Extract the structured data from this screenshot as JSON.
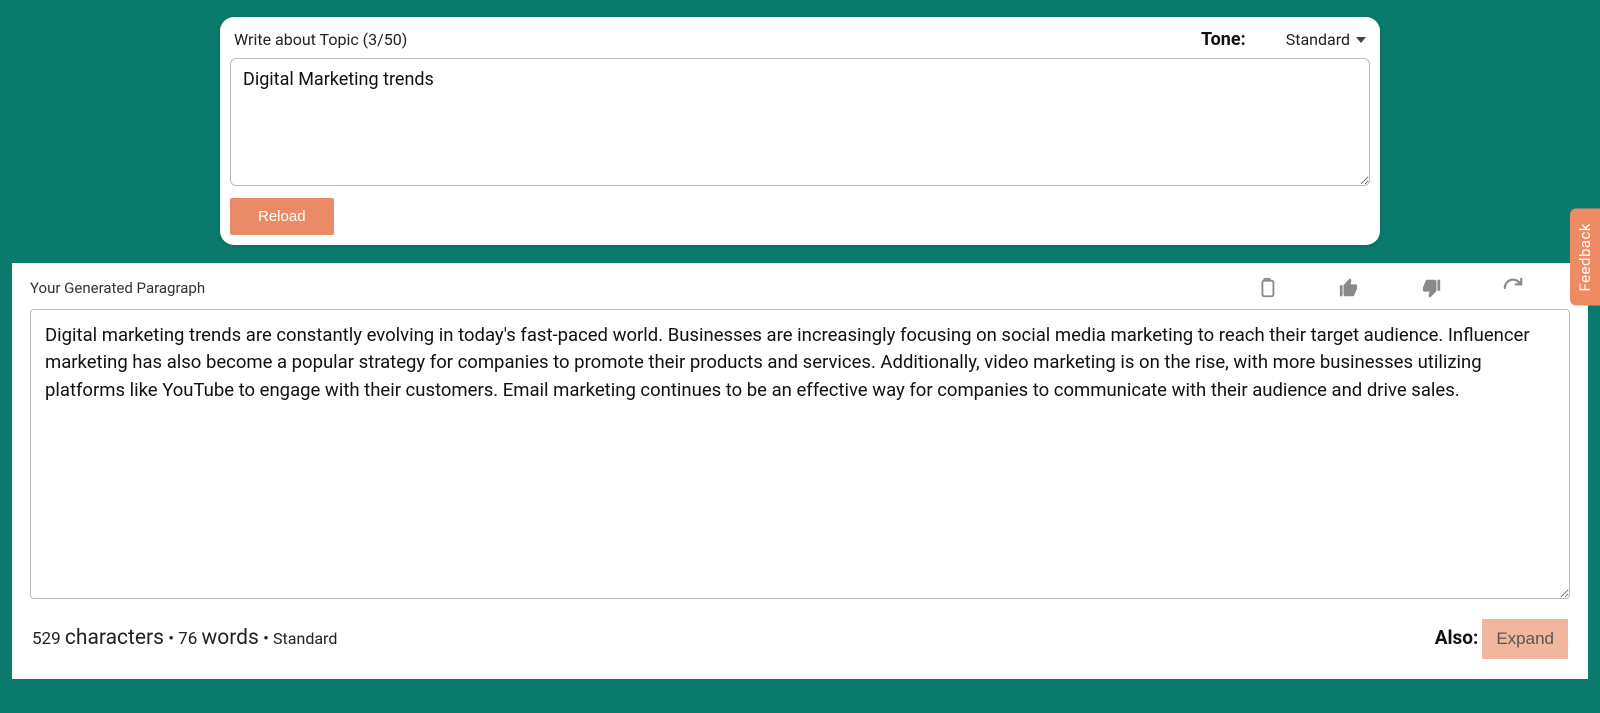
{
  "input": {
    "label": "Write about Topic (3/50)",
    "value": "Digital Marketing trends",
    "tone_label": "Tone:",
    "tone_selected": "Standard",
    "reload_label": "Reload"
  },
  "output": {
    "title": "Your Generated Paragraph",
    "text": "Digital marketing trends are constantly evolving in today's fast-paced world. Businesses are increasingly focusing on social media marketing to reach their target audience. Influencer marketing has also become a popular strategy for companies to promote their products and services. Additionally, video marketing is on the rise, with more businesses utilizing platforms like YouTube to engage with their customers. Email marketing continues to be an effective way for companies to communicate with their audience and drive sales.",
    "stats": {
      "char_count": "529",
      "char_label": "characters",
      "word_count": "76",
      "word_label": "words",
      "tone": "Standard",
      "sep": "•"
    },
    "also_label": "Also:",
    "expand_label": "Expand"
  },
  "feedback_label": "Feedback"
}
